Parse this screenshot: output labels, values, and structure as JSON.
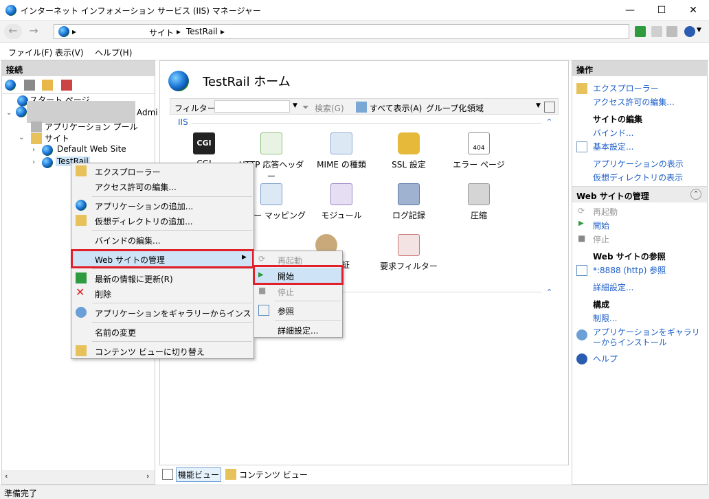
{
  "window": {
    "title": "インターネット インフォメーション サービス (IIS) マネージャー"
  },
  "address": {
    "crumbs": [
      "サイト",
      "TestRail"
    ],
    "sep": "▸"
  },
  "menu": [
    "ファイル(F)",
    "表示(V)",
    "ヘルプ(H)"
  ],
  "connections": {
    "title": "接続",
    "tree": {
      "start_page": "スタート ページ",
      "server_suffix": "Admi",
      "app_pools": "アプリケーション プール",
      "sites": "サイト",
      "default_site": "Default Web Site",
      "testrail": "TestRail"
    }
  },
  "home": {
    "title": "TestRail ホーム",
    "filter_label": "フィルター:",
    "search_label": "検索(G)",
    "show_all": "すべて表示(A)",
    "group_by": "グループ化:",
    "group_value": "領域",
    "section_iis": "IIS",
    "features": [
      "CGI",
      "HTTP 応答ヘッダー",
      "MIME の種類",
      "SSL 設定",
      "エラー ページ",
      "ドラー マッピング",
      "モジュール",
      "ログ記録",
      "圧縮",
      "証",
      "要求フィルター"
    ],
    "cgi_icon_text": "CGI",
    "error_icon_text": "404"
  },
  "bottom_tabs": {
    "features_view": "機能ビュー",
    "content_view": "コンテンツ ビュー"
  },
  "context_menu": {
    "items": [
      "エクスプローラー",
      "アクセス許可の編集...",
      "アプリケーションの追加...",
      "仮想ディレクトリの追加...",
      "バインドの編集...",
      "Web サイトの管理",
      "最新の情報に更新(R)",
      "削除",
      "アプリケーションをギャラリーからインストール",
      "名前の変更",
      "コンテンツ ビューに切り替え"
    ]
  },
  "submenu": {
    "items": [
      "再起動",
      "開始",
      "停止",
      "参照",
      "詳細設定..."
    ]
  },
  "actions": {
    "title": "操作",
    "explore": "エクスプローラー",
    "edit_permissions": "アクセス許可の編集...",
    "edit_site_header": "サイトの編集",
    "bindings": "バインド...",
    "basic_settings": "基本設定...",
    "view_apps": "アプリケーションの表示",
    "view_vdirs": "仮想ディレクトリの表示",
    "manage_site_header": "Web サイトの管理",
    "restart": "再起動",
    "start": "開始",
    "stop": "停止",
    "browse_header": "Web サイトの参照",
    "browse_link": "*:8888 (http) 参照",
    "advanced": "詳細設定...",
    "config_header": "構成",
    "limits": "制限...",
    "install_gallery": "アプリケーションをギャラリーからインストール",
    "help": "ヘルプ"
  },
  "status": {
    "text": "準備完了"
  }
}
